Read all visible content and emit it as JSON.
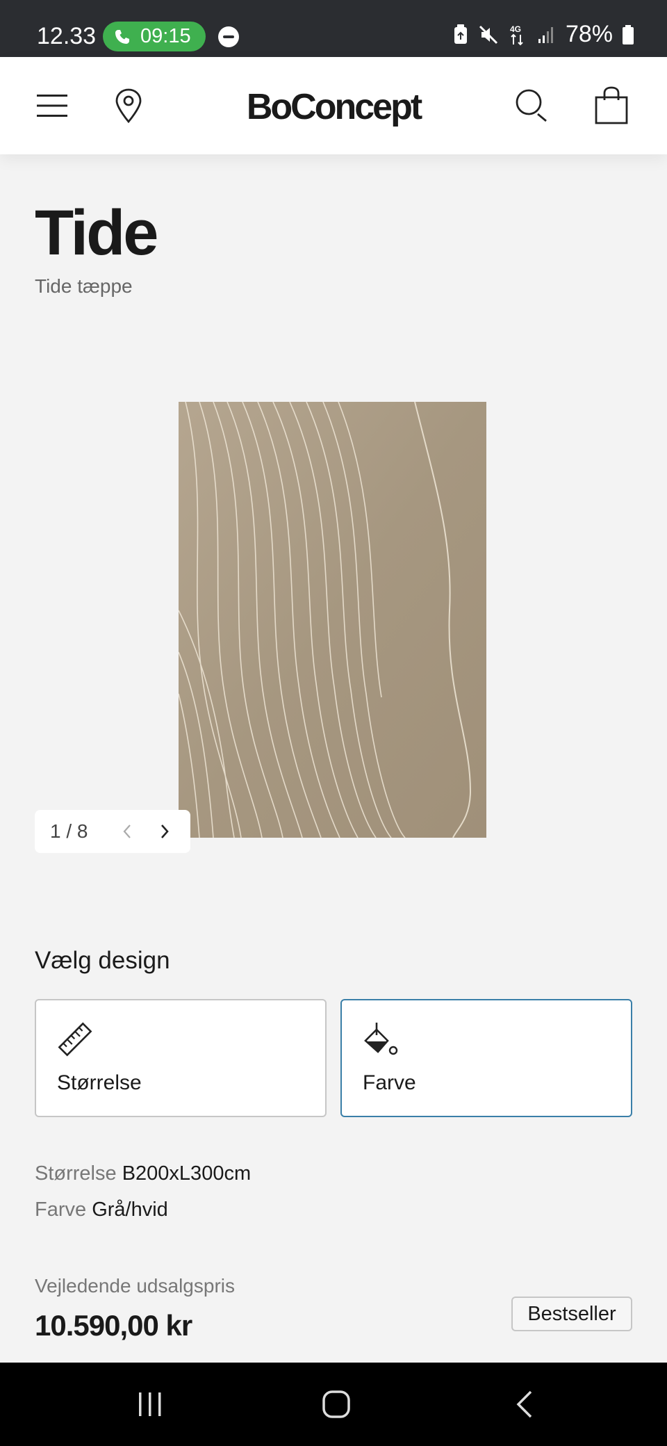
{
  "status_bar": {
    "time": "12.33",
    "call_timer": "09:15",
    "network": "4G",
    "battery": "78%"
  },
  "header": {
    "logo": "BoConcept",
    "icons": [
      "menu-icon",
      "location-pin-icon",
      "search-icon",
      "shopping-bag-icon"
    ]
  },
  "product": {
    "title": "Tide",
    "subtitle": "Tide tæppe",
    "gallery": {
      "counter": "1 / 8"
    }
  },
  "design": {
    "heading": "Vælg design",
    "options": [
      {
        "label": "Størrelse",
        "icon": "ruler-icon",
        "selected": false
      },
      {
        "label": "Farve",
        "icon": "paint-bucket-icon",
        "selected": true
      }
    ]
  },
  "specs": {
    "size_key": "Størrelse",
    "size_value": "B200xL300cm",
    "color_key": "Farve",
    "color_value": "Grå/hvid"
  },
  "pricing": {
    "label": "Vejledende udsalgspris",
    "price": "10.590,00 kr",
    "badge": "Bestseller"
  },
  "colors": {
    "accent_border": "#3a7fa8",
    "call_pill": "#3fb04f",
    "rug_base": "#a99a84"
  }
}
